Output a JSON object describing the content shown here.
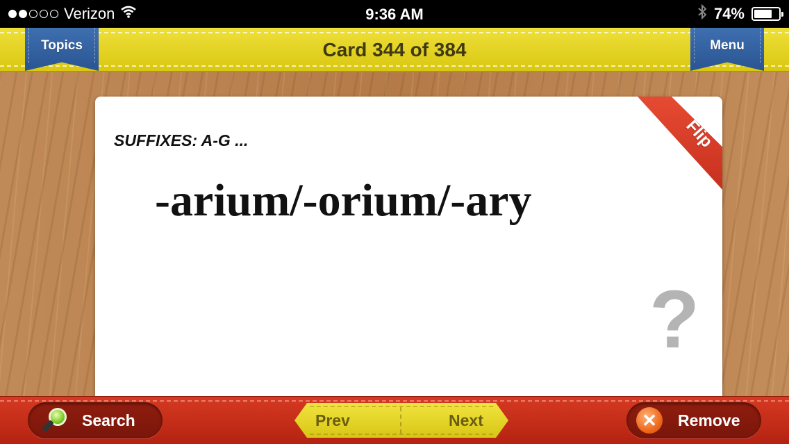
{
  "status_bar": {
    "carrier": "Verizon",
    "signal_bars_filled": 2,
    "signal_bars_total": 5,
    "time": "9:36 AM",
    "battery_percent_label": "74%",
    "battery_level": 0.74,
    "icons": [
      "wifi-icon",
      "bluetooth-icon",
      "battery-icon"
    ]
  },
  "header": {
    "title": "Card 344 of 384",
    "topics_label": "Topics",
    "menu_label": "Menu"
  },
  "card": {
    "category": "SUFFIXES: A-G ...",
    "term": "-arium/-orium/-ary",
    "flip_label": "Flip",
    "help_glyph": "?"
  },
  "toolbar": {
    "search_label": "Search",
    "prev_label": "Prev",
    "next_label": "Next",
    "remove_label": "Remove",
    "remove_glyph": "✕"
  },
  "colors": {
    "header_yellow": "#e6d52a",
    "ribbon_blue": "#2f5d9e",
    "bottom_red": "#c92d19",
    "flip_red": "#d83a25"
  }
}
